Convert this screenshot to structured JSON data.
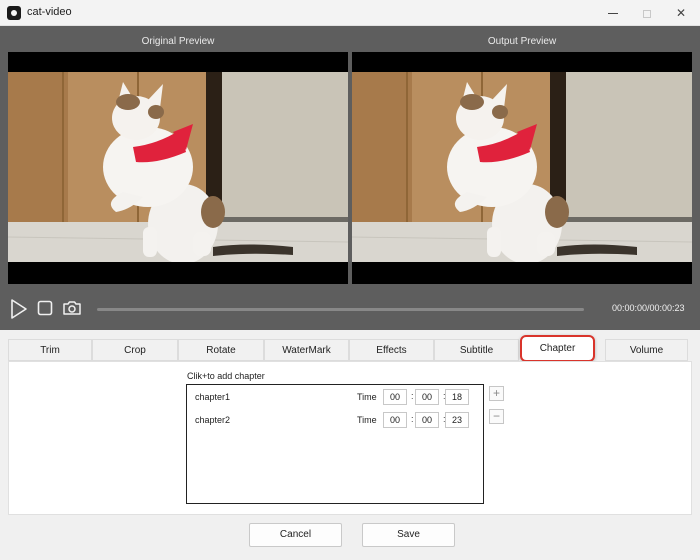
{
  "window": {
    "title": "cat-video",
    "minimize": "—",
    "close": "✕"
  },
  "preview": {
    "original_label": "Original Preview",
    "output_label": "Output Preview"
  },
  "player": {
    "timecode": "00:00:00/00:00:23",
    "progress": 0
  },
  "tabs": [
    {
      "label": "Trim"
    },
    {
      "label": "Crop"
    },
    {
      "label": "Rotate"
    },
    {
      "label": "WaterMark"
    },
    {
      "label": "Effects"
    },
    {
      "label": "Subtitle"
    },
    {
      "label": "Chapter"
    },
    {
      "label": "Volume"
    }
  ],
  "chapter": {
    "hint": "Clik+to add chapter",
    "time_label": "Time",
    "add": "+",
    "remove": "−",
    "items": [
      {
        "name": "chapter1",
        "hh": "00",
        "mm": "00",
        "ss": "18"
      },
      {
        "name": "chapter2",
        "hh": "00",
        "mm": "00",
        "ss": "23"
      }
    ]
  },
  "footer": {
    "cancel": "Cancel",
    "save": "Save"
  },
  "colors": {
    "accent": "#d9342b",
    "preview_bg": "#5e5e5e"
  }
}
